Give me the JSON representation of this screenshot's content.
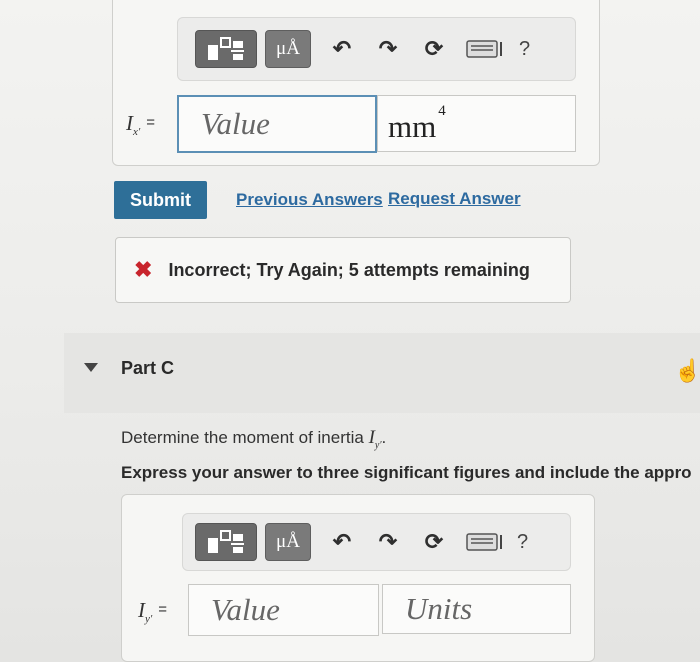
{
  "part_b": {
    "toolbar": {
      "symbol_label": "μÅ",
      "help": "?"
    },
    "eq_label": {
      "var": "I",
      "sub": "x′",
      "eq": "="
    },
    "value_placeholder": "Value",
    "units_text": "mm",
    "units_exp": "4"
  },
  "actions": {
    "submit": "Submit",
    "previous_answers": "Previous Answers",
    "request_answer": "Request Answer"
  },
  "feedback": {
    "icon": "✖",
    "message": "Incorrect; Try Again; 5 attempts remaining"
  },
  "part_c": {
    "title": "Part C",
    "question_prefix": "Determine the moment of inertia",
    "question_var": "I",
    "question_sub": "y′",
    "question_suffix": ".",
    "instruction": "Express your answer to three significant figures and include the appro",
    "toolbar": {
      "symbol_label": "μÅ",
      "help": "?"
    },
    "eq_label": {
      "var": "I",
      "sub": "y′",
      "eq": "="
    },
    "value_placeholder": "Value",
    "units_placeholder": "Units"
  },
  "colors": {
    "submit_bg": "#2e6f98",
    "link": "#2d6aa0",
    "error": "#c8242c"
  }
}
